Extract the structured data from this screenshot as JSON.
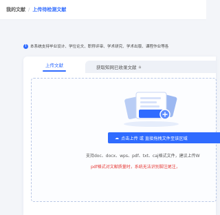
{
  "breadcrumb": {
    "root": "我的文献",
    "separator": "/",
    "current": "上传待检测文献"
  },
  "notice": {
    "icon": "info-icon",
    "text": "本系统支持毕业设计、学位论文、职称评审、学术研究、学术出版、课程作业等各"
  },
  "tabs": {
    "active_label": "上传文献",
    "inactive_label": "获取知网已收录文献",
    "inactive_icon": "home-icon"
  },
  "dropzone": {
    "button_label": "点击上传 或 直接拖拽文件至该区域",
    "button_icon": "cloud-upload-icon",
    "support_text": "支持doc、docx、wps、pdf、txt、caj格式文件，建议上传W",
    "warning_text": "pdf格式对文献质量时，系统无法识别脚注尾注，"
  },
  "colors": {
    "primary": "#2f6bff",
    "warning": "#e53935",
    "background": "#f3f5f9"
  }
}
